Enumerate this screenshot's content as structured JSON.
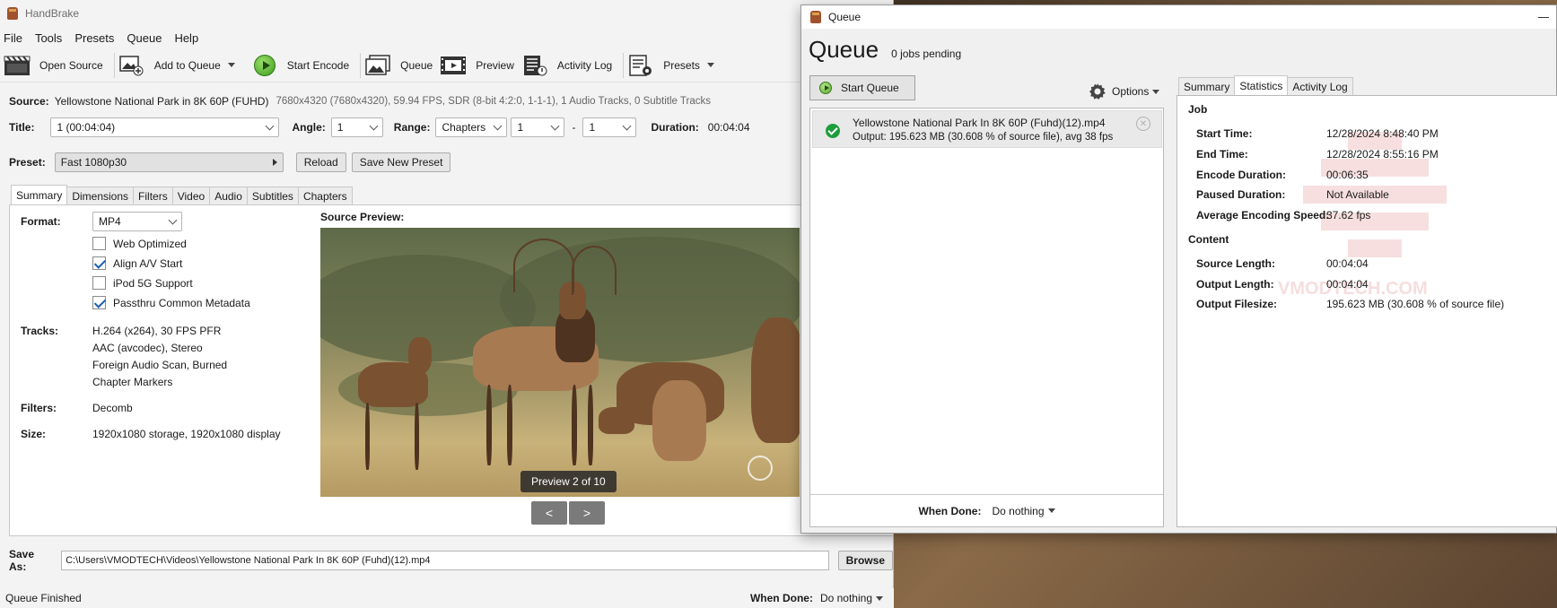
{
  "main_window": {
    "title": "HandBrake",
    "menu": [
      "File",
      "Tools",
      "Presets",
      "Queue",
      "Help"
    ],
    "toolbar": {
      "open_source": "Open Source",
      "add_to_queue": "Add to Queue",
      "start_encode": "Start Encode",
      "queue": "Queue",
      "preview": "Preview",
      "activity_log": "Activity Log",
      "presets": "Presets"
    },
    "source": {
      "label": "Source:",
      "name": "Yellowstone National Park in 8K 60P (FUHD)",
      "meta": "7680x4320 (7680x4320), 59.94 FPS, SDR (8-bit 4:2:0, 1-1-1), 1 Audio Tracks, 0 Subtitle Tracks"
    },
    "title_row": {
      "title_label": "Title:",
      "title_value": "1  (00:04:04)",
      "angle_label": "Angle:",
      "angle_value": "1",
      "range_label": "Range:",
      "range_type": "Chapters",
      "range_start": "1",
      "range_sep": "-",
      "range_end": "1",
      "duration_label": "Duration:",
      "duration_value": "00:04:04"
    },
    "preset_row": {
      "label": "Preset:",
      "value": "Fast 1080p30",
      "reload": "Reload",
      "save_new": "Save New Preset"
    },
    "tabs": [
      "Summary",
      "Dimensions",
      "Filters",
      "Video",
      "Audio",
      "Subtitles",
      "Chapters"
    ],
    "summary": {
      "format_label": "Format:",
      "format_value": "MP4",
      "web_optimized": "Web Optimized",
      "align_av": "Align A/V Start",
      "ipod": "iPod 5G Support",
      "passthru": "Passthru Common Metadata",
      "tracks_label": "Tracks:",
      "tracks": [
        "H.264 (x264), 30 FPS PFR",
        "AAC (avcodec), Stereo",
        "Foreign Audio Scan, Burned",
        "Chapter Markers"
      ],
      "filters_label": "Filters:",
      "filters_value": "Decomb",
      "size_label": "Size:",
      "size_value": "1920x1080 storage, 1920x1080 display",
      "source_preview_label": "Source Preview:",
      "preview_counter": "Preview 2 of 10",
      "prev_btn": "<",
      "next_btn": ">"
    },
    "save_as": {
      "label": "Save As:",
      "path": "C:\\Users\\VMODTECH\\Videos\\Yellowstone National Park In 8K 60P (Fuhd)(12).mp4",
      "browse": "Browse"
    },
    "status": {
      "text": "Queue Finished",
      "when_done_label": "When Done:",
      "when_done_value": "Do nothing"
    }
  },
  "queue_window": {
    "title": "Queue",
    "heading": "Queue",
    "pending": "0 jobs pending",
    "start_queue": "Start Queue",
    "options": "Options",
    "item": {
      "name": "Yellowstone National Park In 8K 60P (Fuhd)(12).mp4",
      "output": "Output: 195.623 MB (30.608 % of source file), avg 38 fps"
    },
    "when_done_label": "When Done:",
    "when_done_value": "Do nothing",
    "tabs": [
      "Summary",
      "Statistics",
      "Activity Log"
    ],
    "stats": {
      "job_heading": "Job",
      "start_time_label": "Start Time:",
      "start_time": "12/28/2024 8:48:40 PM",
      "end_time_label": "End Time:",
      "end_time": "12/28/2024 8:55:16 PM",
      "encode_duration_label": "Encode Duration:",
      "encode_duration": "00:06:35",
      "paused_duration_label": "Paused Duration:",
      "paused_duration": "Not Available",
      "avg_speed_label": "Average Encoding Speed:",
      "avg_speed": "37.62 fps",
      "content_heading": "Content",
      "source_length_label": "Source Length:",
      "source_length": "00:04:04",
      "output_length_label": "Output Length:",
      "output_length": "00:04:04",
      "output_filesize_label": "Output Filesize:",
      "output_filesize": "195.623 MB (30.608 % of source file)"
    },
    "watermark": "VMODTECH.COM"
  }
}
